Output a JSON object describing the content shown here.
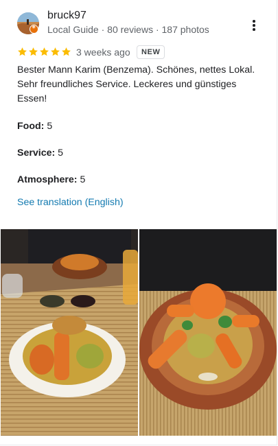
{
  "reviewer": {
    "name": "bruck97",
    "meta": "Local Guide · 80 reviews · 187 photos"
  },
  "review": {
    "rating": 5,
    "time": "3 weeks ago",
    "new_label": "NEW",
    "text": "Bester Mann Karim (Benzema). Schönes, nettes Lokal. Sehr freundliches Service. Leckeres und günstiges Essen!",
    "attributes": [
      {
        "label": "Food:",
        "value": "5"
      },
      {
        "label": "Service:",
        "value": "5"
      },
      {
        "label": "Atmosphere:",
        "value": "5"
      }
    ],
    "translate_link": "See translation (English)"
  },
  "colors": {
    "star": "#fbbc04",
    "link": "#137ab0",
    "secondary_text": "#5f6368"
  },
  "icons": {
    "more": "more-vert-icon",
    "local_guide_badge": "local-guide-badge-icon"
  }
}
